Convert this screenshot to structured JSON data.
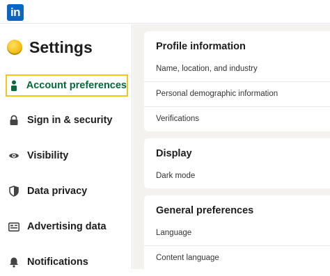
{
  "brand": {
    "logo_text": "in",
    "color": "#0a66c2"
  },
  "sidebar": {
    "title": "Settings",
    "items": [
      {
        "label": "Account preferences",
        "icon": "person-icon",
        "active": true
      },
      {
        "label": "Sign in & security",
        "icon": "lock-icon"
      },
      {
        "label": "Visibility",
        "icon": "eye-icon"
      },
      {
        "label": "Data privacy",
        "icon": "shield-icon"
      },
      {
        "label": "Advertising data",
        "icon": "ad-icon"
      },
      {
        "label": "Notifications",
        "icon": "bell-icon"
      }
    ]
  },
  "sections": [
    {
      "title": "Profile information",
      "rows": [
        "Name, location, and industry",
        "Personal demographic information",
        "Verifications"
      ]
    },
    {
      "title": "Display",
      "rows": [
        "Dark mode"
      ]
    },
    {
      "title": "General preferences",
      "rows": [
        "Language",
        "Content language"
      ]
    }
  ],
  "colors": {
    "active_outline": "#f5c518",
    "active_text": "#056b3a",
    "main_bg": "#f4f2ee"
  }
}
